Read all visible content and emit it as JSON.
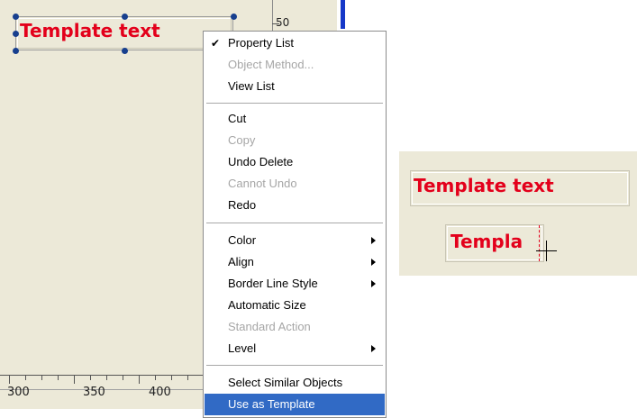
{
  "editor": {
    "template_object_text": "Template text",
    "vertical_ruler_label": "50",
    "horizontal_ruler_labels": [
      "300",
      "350",
      "400"
    ]
  },
  "context_menu": {
    "items": [
      {
        "label": "Property List",
        "checked": true,
        "enabled": true
      },
      {
        "label": "Object Method...",
        "enabled": false
      },
      {
        "label": "View List",
        "enabled": true
      },
      {
        "label": "Cut",
        "enabled": true
      },
      {
        "label": "Copy",
        "enabled": false
      },
      {
        "label": "Undo Delete",
        "enabled": true
      },
      {
        "label": "Cannot Undo",
        "enabled": false
      },
      {
        "label": "Redo",
        "enabled": true
      },
      {
        "label": "Color",
        "submenu": true,
        "enabled": true
      },
      {
        "label": "Align",
        "submenu": true,
        "enabled": true
      },
      {
        "label": "Border Line Style",
        "submenu": true,
        "enabled": true
      },
      {
        "label": "Automatic Size",
        "enabled": true
      },
      {
        "label": "Standard Action",
        "enabled": false
      },
      {
        "label": "Level",
        "submenu": true,
        "enabled": true
      },
      {
        "label": "Select Similar Objects",
        "enabled": true
      },
      {
        "label": "Use as Template",
        "enabled": true,
        "highlighted": true
      }
    ]
  },
  "preview": {
    "template_text_full": "Template text",
    "template_text_partial": "Templa"
  },
  "colors": {
    "template_text": "#e3001b",
    "panel_background": "#ece9d8",
    "menu_highlight": "#316ac5",
    "selection_handle": "#173f8e"
  }
}
